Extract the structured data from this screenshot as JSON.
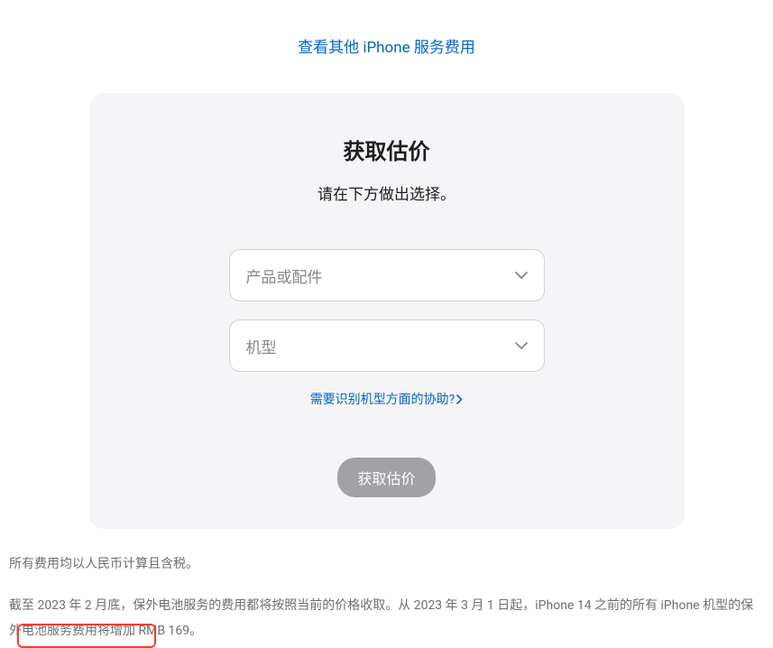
{
  "topLink": {
    "text": "查看其他 iPhone 服务费用"
  },
  "card": {
    "title": "获取估价",
    "subtitle": "请在下方做出选择。",
    "select1": {
      "placeholder": "产品或配件"
    },
    "select2": {
      "placeholder": "机型"
    },
    "helpLink": "需要识别机型方面的协助?",
    "submitLabel": "获取估价"
  },
  "footer": {
    "note1": "所有费用均以人民币计算且含税。",
    "note2": "截至 2023 年 2 月底，保外电池服务的费用都将按照当前的价格收取。从 2023 年 3 月 1 日起，iPhone 14 之前的所有 iPhone 机型的保外电池服务费用将增加 RMB 169。"
  }
}
